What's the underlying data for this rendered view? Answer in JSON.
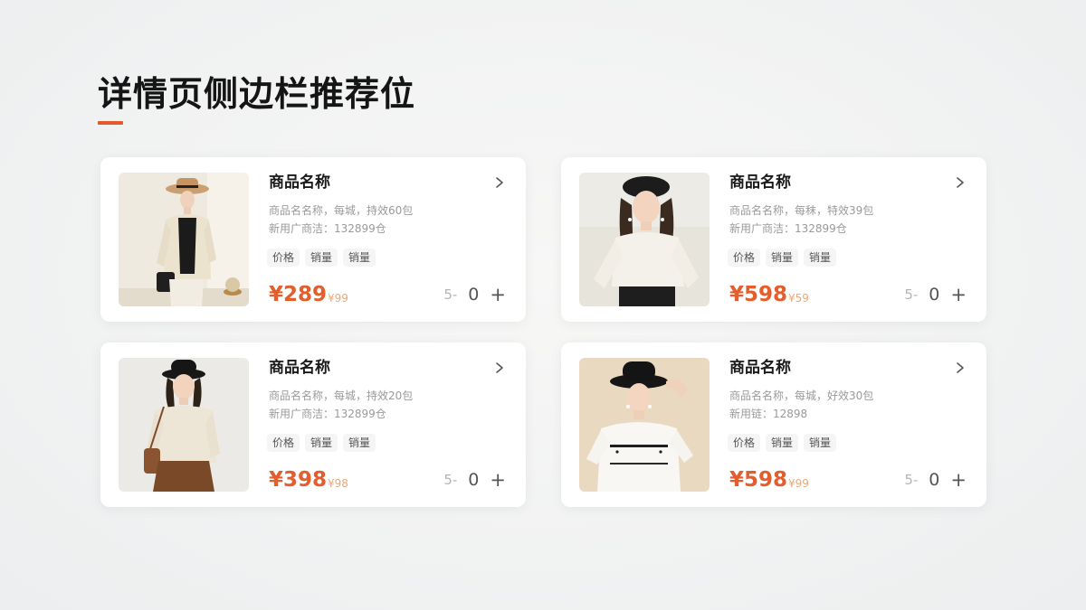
{
  "page": {
    "title": "详情页侧边栏推荐位",
    "accent_color": "#e2592b"
  },
  "tag_labels": [
    "价格",
    "销量",
    "销量"
  ],
  "products": [
    {
      "name": "商品名称",
      "desc_line1": "商品名名称，每城，持效60包",
      "desc_line2": "新用广商洁：132899仓",
      "price": "¥289",
      "old_price": "¥99",
      "stepper_minus": "5-",
      "quantity": "0",
      "stepper_plus": "+",
      "image": "woman-beige-jacket-straw-hat"
    },
    {
      "name": "商品名称",
      "desc_line1": "商品名名称，每秣，特效39包",
      "desc_line2": "新用广商洁：132899仓",
      "price": "¥598",
      "old_price": "¥59",
      "stepper_minus": "5-",
      "quantity": "0",
      "stepper_plus": "+",
      "image": "woman-white-blouse-beret"
    },
    {
      "name": "商品名称",
      "desc_line1": "商品名名称，每城，持效20包",
      "desc_line2": "新用广商洁：132899仓",
      "price": "¥398",
      "old_price": "¥98",
      "stepper_minus": "5-",
      "quantity": "0",
      "stepper_plus": "+",
      "image": "woman-cream-sweater-bucket-hat"
    },
    {
      "name": "商品名称",
      "desc_line1": "商品名名称，每城，好效30包",
      "desc_line2": "新用链：12898",
      "price": "¥598",
      "old_price": "¥99",
      "stepper_minus": "5-",
      "quantity": "0",
      "stepper_plus": "+",
      "image": "woman-white-tshirt-bucket-hat"
    }
  ],
  "colors": {
    "price": "#e35d2d",
    "old_price": "#e8a87a"
  }
}
